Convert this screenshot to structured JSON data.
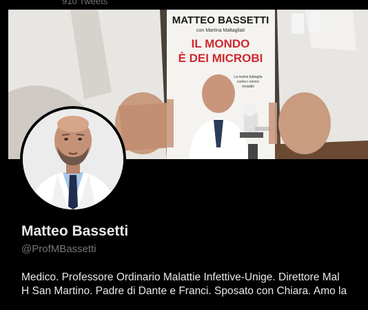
{
  "header": {
    "tweet_count": "910 Tweets"
  },
  "banner": {
    "book_author": "MATTEO BASSETTI",
    "book_coauthor": "con Martina Maltagliati",
    "book_title_line1": "IL MONDO",
    "book_title_line2": "È DEI MICROBI",
    "book_tagline_line1": "La nostra battaglia",
    "book_tagline_line2": "contro i nemici",
    "book_tagline_line3": "invisibili"
  },
  "profile": {
    "display_name": "Matteo Bassetti",
    "handle": "@ProfMBassetti",
    "bio_line1": "Medico. Professore Ordinario Malattie Infettive-Unige. Direttore Mal",
    "bio_line2": "H San Martino. Padre di Dante e Franci. Sposato con Chiara. Amo la"
  },
  "colors": {
    "background": "#000000",
    "primary_text": "#e7e9ea",
    "secondary_text": "#71767b",
    "book_title_red": "#d0282e"
  }
}
